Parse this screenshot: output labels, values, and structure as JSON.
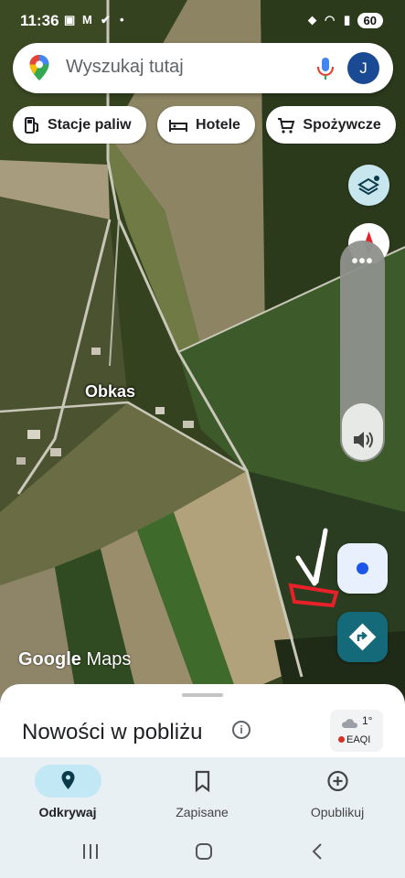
{
  "status_bar": {
    "time": "11:36",
    "battery": "60",
    "icons": [
      "screenshot-icon",
      "gmail-icon",
      "check-icon",
      "dot-icon",
      "location-icon",
      "wifi-icon",
      "signal-icon"
    ]
  },
  "search": {
    "placeholder": "Wyszukaj tutaj",
    "avatar_letter": "J"
  },
  "chips": [
    {
      "label": "Stacje paliw",
      "icon": "gas-station-icon"
    },
    {
      "label": "Hotele",
      "icon": "bed-icon"
    },
    {
      "label": "Spożywcze",
      "icon": "cart-icon"
    }
  ],
  "map": {
    "place_label": "Obkas",
    "watermark_google": "Google",
    "watermark_maps": "Maps"
  },
  "volume": {
    "dots": "•••"
  },
  "sheet": {
    "title": "Nowości w pobliżu",
    "temperature": "1°",
    "air_quality": "EAQI"
  },
  "nav": {
    "items": [
      {
        "label": "Odkrywaj",
        "icon": "location-pin-icon",
        "selected": true
      },
      {
        "label": "Zapisane",
        "icon": "bookmark-icon",
        "selected": false
      },
      {
        "label": "Opublikuj",
        "icon": "add-circle-icon",
        "selected": false
      }
    ]
  },
  "colors": {
    "accent": "#1a56e8",
    "directions": "#156a7a",
    "nav_selected": "#c2e7f5",
    "annotation": "#e8202a"
  }
}
